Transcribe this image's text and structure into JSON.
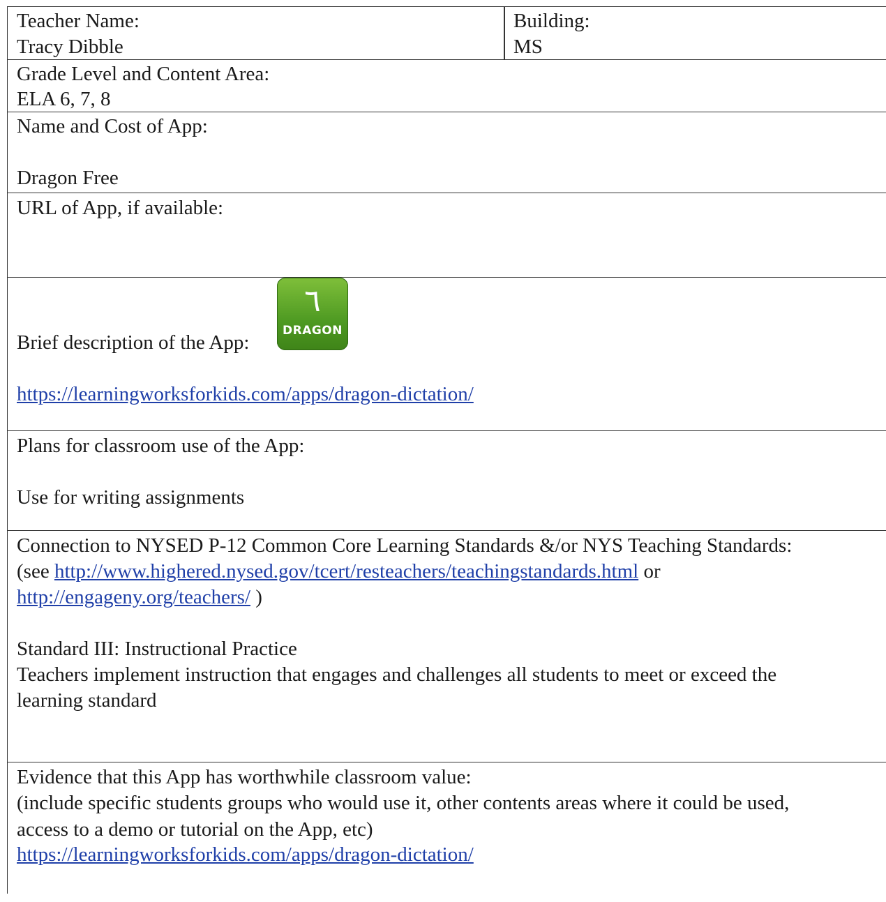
{
  "teacher": {
    "label": "Teacher Name:",
    "value": "Tracy Dibble"
  },
  "building": {
    "label": "Building:",
    "value": "MS"
  },
  "grade": {
    "label": "Grade Level and Content Area:",
    "value": "ELA 6, 7, 8"
  },
  "app_name": {
    "label": "Name and Cost of App:",
    "value": "Dragon Free"
  },
  "app_url": {
    "label": "URL of App, if available:"
  },
  "description": {
    "label": "Brief description of the App:",
    "icon_text": "DRAGON",
    "icon_name": "dragon-app-icon",
    "link": "https://learningworksforkids.com/apps/dragon-dictation/"
  },
  "plans": {
    "label": "Plans for classroom use of the App:",
    "value": "Use for writing assignments"
  },
  "connection": {
    "label": "Connection to NYSED P-12 Common Core Learning Standards &/or NYS Teaching Standards:",
    "see_prefix": "(see ",
    "link1": "http://www.highered.nysed.gov/tcert/resteachers/teachingstandards.html",
    "or_text": " or",
    "link2": "http://engageny.org/teachers/",
    "close_text": " )",
    "standard_title": "Standard III:  Instructional Practice",
    "standard_text_line1": "Teachers implement instruction that engages and challenges all students to meet or exceed the",
    "standard_text_line2": "learning standard"
  },
  "evidence": {
    "label": "Evidence that this App has worthwhile classroom value:",
    "detail_line1": "(include specific students groups who would use it, other contents areas where it could be used,",
    "detail_line2": "access to a demo or tutorial on the App, etc)",
    "link": "https://learningworksforkids.com/apps/dragon-dictation/"
  },
  "colors": {
    "link": "#1f3fa8",
    "icon_green": "#4e9a22"
  }
}
